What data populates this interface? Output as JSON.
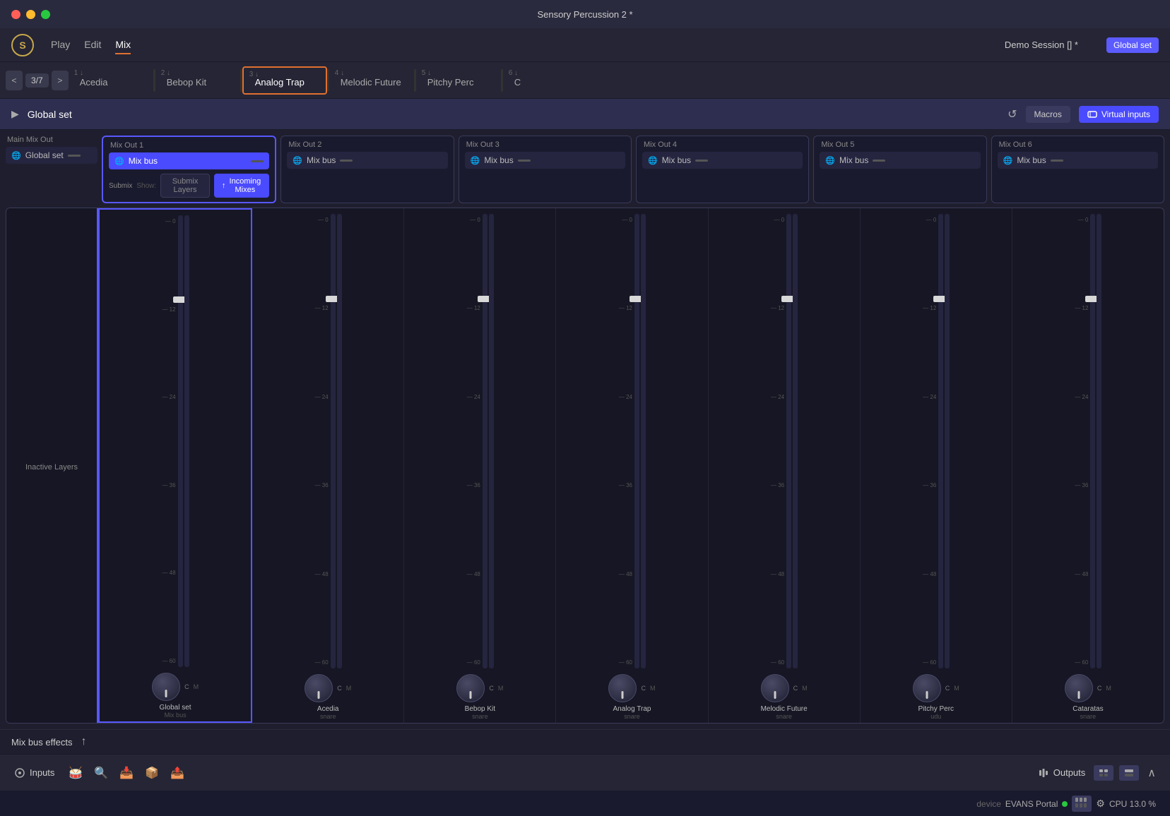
{
  "titlebar": {
    "title": "Sensory Percussion 2 *",
    "traffic": [
      "close",
      "minimize",
      "maximize"
    ]
  },
  "menubar": {
    "logo": "S",
    "items": [
      "Play",
      "Edit",
      "Mix"
    ],
    "active_item": "Mix",
    "session": "Demo Session [] *",
    "global_set": "Global set"
  },
  "kit_tabs": {
    "nav_prev": "<",
    "nav_next": ">",
    "current": "3",
    "total": "7",
    "tabs": [
      {
        "num": "1",
        "name": "Acedia"
      },
      {
        "num": "2",
        "name": "Bebop Kit"
      },
      {
        "num": "3",
        "name": "Analog Trap",
        "active": true
      },
      {
        "num": "4",
        "name": "Melodic Future"
      },
      {
        "num": "5",
        "name": "Pitchy Perc"
      },
      {
        "num": "6",
        "name": "C"
      }
    ]
  },
  "global_set": {
    "title": "Global set",
    "refresh": "↺",
    "macros": "Macros",
    "virtual_inputs": "Virtual inputs"
  },
  "mix_view": {
    "main_mix": {
      "label": "Main Mix Out",
      "bus": "Global set",
      "submix_label": "Inactive Layers",
      "inactive_layers": "Inactive Layers",
      "submix": "Submix"
    },
    "mix_outs": [
      {
        "label": "Mix Out 1",
        "bus": "Mix bus",
        "selected": true,
        "show_tabs": true
      },
      {
        "label": "Mix Out 2",
        "bus": "Mix bus"
      },
      {
        "label": "Mix Out 3",
        "bus": "Mix bus"
      },
      {
        "label": "Mix Out 4",
        "bus": "Mix bus"
      },
      {
        "label": "Mix Out 5",
        "bus": "Mix bus"
      },
      {
        "label": "Mix Out 6",
        "bus": "Mix bus"
      }
    ],
    "show_label": "Show:",
    "submix_layers_btn": "Submix Layers",
    "incoming_mixes_btn": "Incoming Mixes"
  },
  "channels": [
    {
      "name": "Global set",
      "sub": "Mix bus",
      "knob": "C",
      "selected": true
    },
    {
      "name": "Acedia",
      "sub": "snare",
      "knob": "C"
    },
    {
      "name": "Bebop Kit",
      "sub": "snare",
      "knob": "C"
    },
    {
      "name": "Analog Trap",
      "sub": "snare",
      "knob": "C"
    },
    {
      "name": "Melodic Future",
      "sub": "snare",
      "knob": "C"
    },
    {
      "name": "Pitchy Perc",
      "sub": "udu",
      "knob": "C"
    },
    {
      "name": "Cataratas",
      "sub": "snare",
      "knob": "C"
    }
  ],
  "scale_values": [
    "0",
    "12",
    "24",
    "36",
    "48",
    "60"
  ],
  "mix_bus_effects": "Mix bus effects",
  "transport": {
    "inputs": "Inputs",
    "outputs": "Outputs"
  },
  "status": {
    "device_label": "device",
    "device_name": "EVANS Portal",
    "cpu_label": "CPU",
    "cpu_value": "13.0 %"
  }
}
